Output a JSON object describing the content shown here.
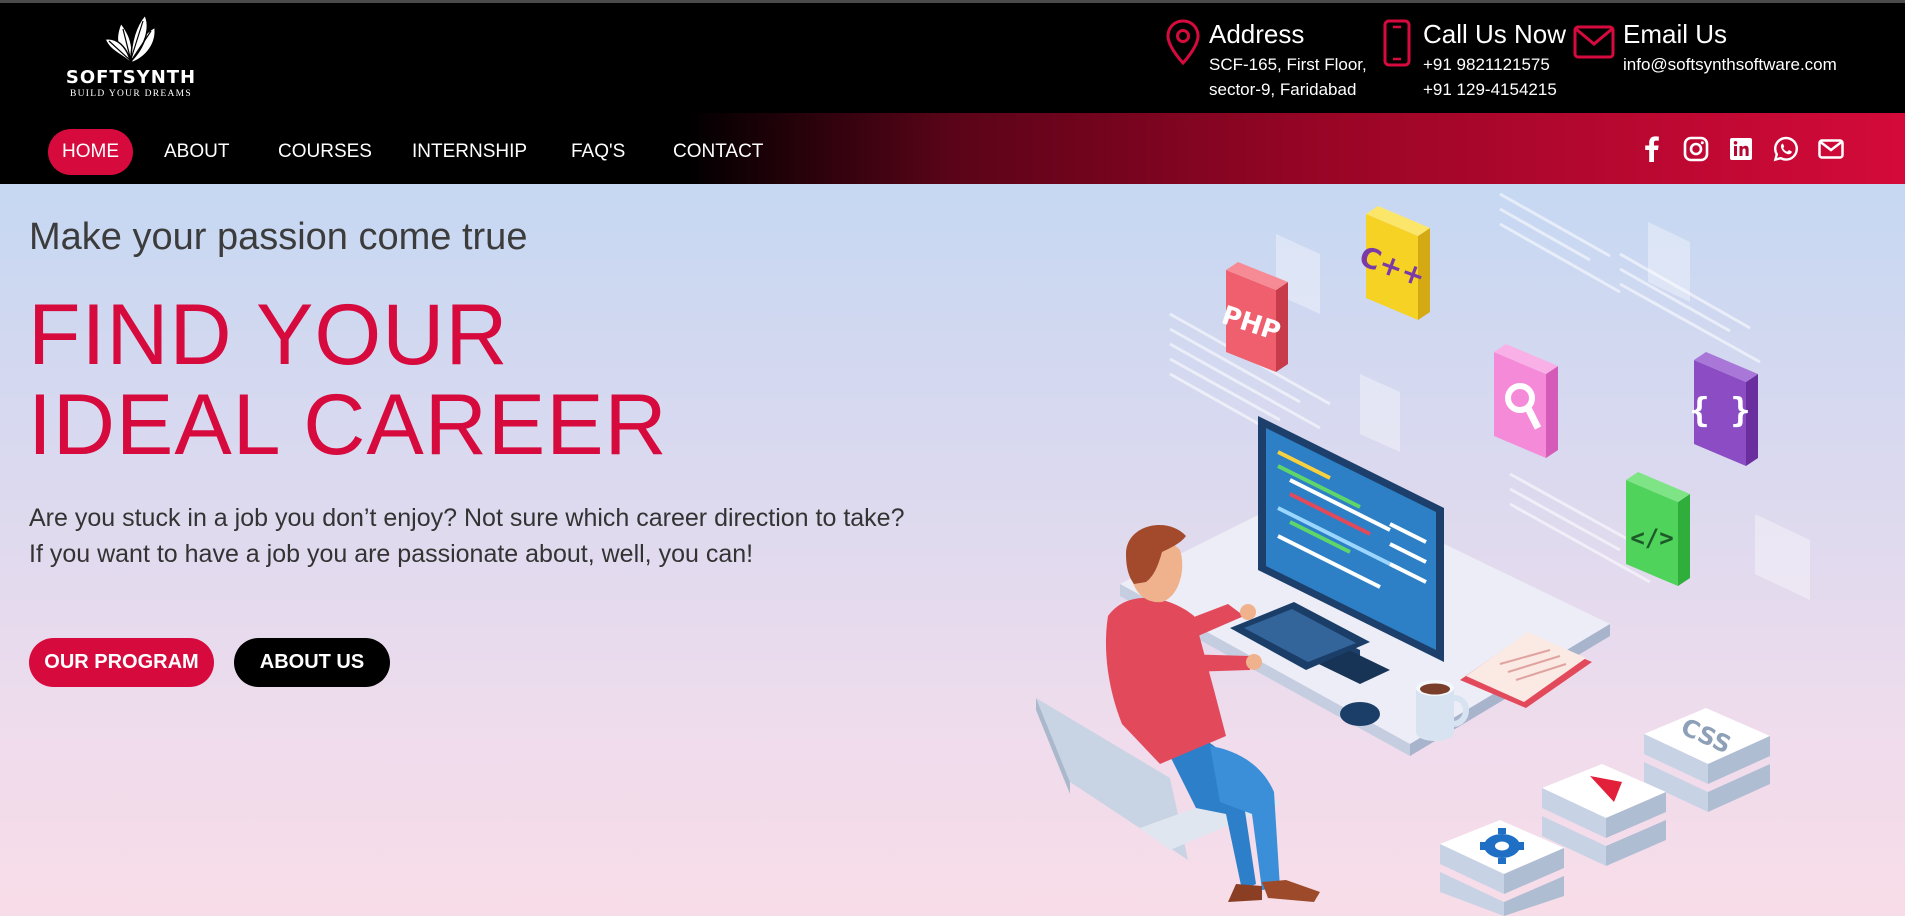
{
  "brand": {
    "name": "SOFTSYNTH",
    "tagline": "BUILD YOUR DREAMS"
  },
  "contact": {
    "address": {
      "title": "Address",
      "line1": "SCF-165, First Floor,",
      "line2": "sector-9, Faridabad",
      "icon": "map-pin-icon"
    },
    "call": {
      "title": "Call Us Now",
      "line1": "+91 9821121575",
      "line2": "+91 129-4154215",
      "icon": "phone-icon"
    },
    "email": {
      "title": "Email Us",
      "line1": "info@softsynthsoftware.com",
      "icon": "envelope-icon"
    }
  },
  "nav": {
    "items": [
      {
        "label": "HOME",
        "active": true
      },
      {
        "label": "ABOUT"
      },
      {
        "label": "COURSES"
      },
      {
        "label": "INTERNSHIP"
      },
      {
        "label": "FAQ'S"
      },
      {
        "label": "CONTACT"
      }
    ]
  },
  "socials": [
    "facebook-icon",
    "instagram-icon",
    "linkedin-icon",
    "whatsapp-icon",
    "mail-icon"
  ],
  "hero": {
    "tagline": "Make your passion come true",
    "headline_line1": "FIND YOUR",
    "headline_line2": "IDEAL CAREER",
    "desc_line1": "Are you stuck in a job you don’t enjoy? Not sure which career direction to take?",
    "desc_line2": "If you want to have a job you are passionate about, well, you can!",
    "btn_program": "OUR PROGRAM",
    "btn_about": "ABOUT US"
  },
  "illustration": {
    "php": "PHP",
    "cpp": "C++",
    "css": "CSS",
    "curly": "{ }",
    "code": "</>"
  },
  "colors": {
    "accent": "#d70a3e",
    "header_bg": "#000000"
  }
}
